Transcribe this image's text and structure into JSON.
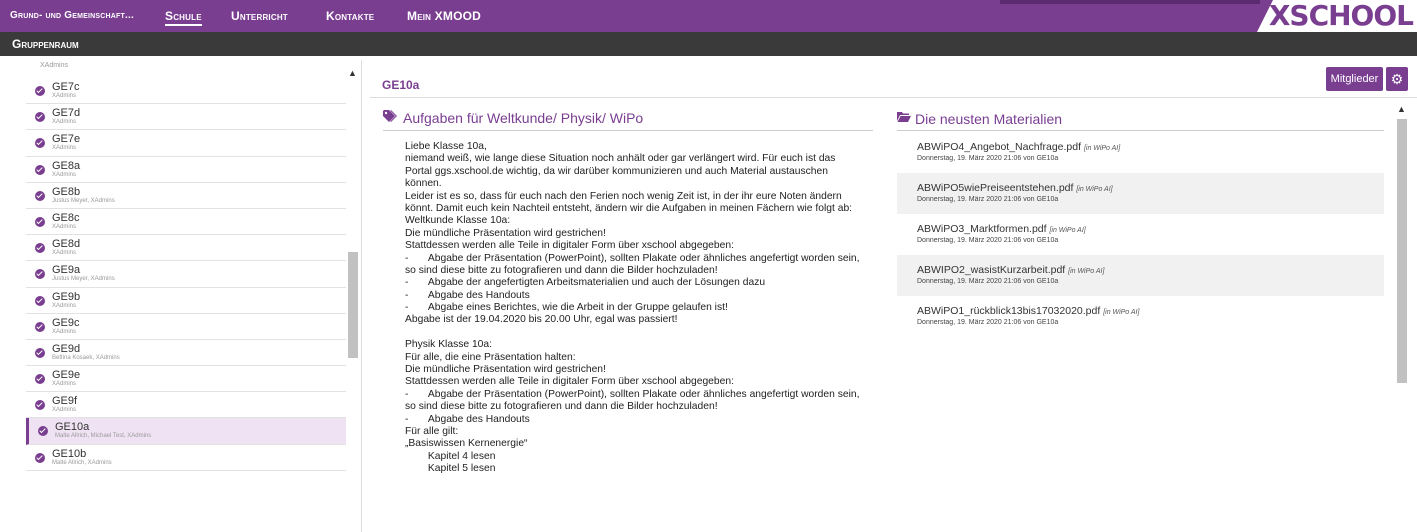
{
  "topnav": {
    "items": [
      {
        "label": "Grund- und Gemeinschaft...",
        "active": false
      },
      {
        "label": "Schule",
        "active": true
      },
      {
        "label": "Unterricht",
        "active": false
      },
      {
        "label": "Kontakte",
        "active": false
      },
      {
        "label": "Mein XMOOD",
        "active": false
      }
    ],
    "logo": "XSCHOOL"
  },
  "subbar": {
    "title": "Gruppenraum"
  },
  "sidebar": {
    "top_partial": "XAdmins",
    "items": [
      {
        "name": "GE7c",
        "sub": "XAdmins",
        "active": false
      },
      {
        "name": "GE7d",
        "sub": "XAdmins",
        "active": false
      },
      {
        "name": "GE7e",
        "sub": "XAdmins",
        "active": false
      },
      {
        "name": "GE8a",
        "sub": "XAdmins",
        "active": false
      },
      {
        "name": "GE8b",
        "sub": "Justus Meyer, XAdmins",
        "active": false
      },
      {
        "name": "GE8c",
        "sub": "XAdmins",
        "active": false
      },
      {
        "name": "GE8d",
        "sub": "XAdmins",
        "active": false
      },
      {
        "name": "GE9a",
        "sub": "Justus Meyer, XAdmins",
        "active": false
      },
      {
        "name": "GE9b",
        "sub": "XAdmins",
        "active": false
      },
      {
        "name": "GE9c",
        "sub": "XAdmins",
        "active": false
      },
      {
        "name": "GE9d",
        "sub": "Bettina Kosaek, XAdmins",
        "active": false
      },
      {
        "name": "GE9e",
        "sub": "XAdmins",
        "active": false
      },
      {
        "name": "GE9f",
        "sub": "XAdmins",
        "active": false
      },
      {
        "name": "GE10a",
        "sub": "Malte Allrich, Michael Test, XAdmins",
        "active": true
      },
      {
        "name": "GE10b",
        "sub": "Malte Allrich, XAdmins",
        "active": false
      }
    ]
  },
  "main": {
    "title": "GE10a",
    "members_label": "Mitglieder",
    "tasks": {
      "title": "Aufgaben für Weltkunde/ Physik/ WiPo",
      "lines": [
        "Liebe Klasse 10a,",
        "niemand weiß, wie lange diese Situation noch anhält oder gar verlängert wird. Für euch ist das",
        "Portal ggs.xschool.de wichtig, da wir darüber kommunizieren und auch Material austauschen",
        "können.",
        "Leider ist es so, dass für euch nach den Ferien noch wenig Zeit ist, in der ihr eure Noten ändern",
        "könnt. Damit euch kein Nachteil entsteht, ändern wir die Aufgaben in meinen Fächern wie folgt ab:",
        "Weltkunde Klasse 10a:",
        "Die mündliche Präsentation wird gestrichen!",
        "Stattdessen werden alle Teile in digitaler Form über xschool abgegeben:",
        "-       Abgabe der Präsentation (PowerPoint), sollten Plakate oder ähnliches angefertigt worden sein,",
        "so sind diese bitte zu fotografieren und dann die Bilder hochzuladen!",
        "-       Abgabe der angefertigten Arbeitsmaterialien und auch der Lösungen dazu",
        "-       Abgabe des Handouts",
        "-       Abgabe eines Berichtes, wie die Arbeit in der Gruppe gelaufen ist!",
        "Abgabe ist der 19.04.2020 bis 20.00 Uhr, egal was passiert!",
        "",
        "Physik Klasse 10a:",
        "Für alle, die eine Präsentation halten:",
        "Die mündliche Präsentation wird gestrichen!",
        "Stattdessen werden alle Teile in digitaler Form über xschool abgegeben:",
        "-       Abgabe der Präsentation (PowerPoint), sollten Plakate oder ähnliches angefertigt worden sein,",
        "so sind diese bitte zu fotografieren und dann die Bilder hochzuladen!",
        "-       Abgabe des Handouts",
        "Für alle gilt:",
        "„Basiswissen Kernenergie“",
        "        Kapitel 4 lesen",
        "        Kapitel 5 lesen"
      ]
    },
    "materials": {
      "title": "Die neusten Materialien",
      "items": [
        {
          "file": "ABWiPO4_Angebot_Nachfrage.pdf",
          "tag": "[in WiPo AI]",
          "meta": "Donnerstag, 19. März 2020 21:06 von GE10a"
        },
        {
          "file": "ABWiPO5wiePreiseentstehen.pdf",
          "tag": "[in WiPo AI]",
          "meta": "Donnerstag, 19. März 2020 21:06 von GE10a"
        },
        {
          "file": "ABWiPO3_Marktformen.pdf",
          "tag": "[in WiPo AI]",
          "meta": "Donnerstag, 19. März 2020 21:06 von GE10a"
        },
        {
          "file": "ABWIPO2_wasistKurzarbeit.pdf",
          "tag": "[in WiPo AI]",
          "meta": "Donnerstag, 19. März 2020 21:06 von GE10a"
        },
        {
          "file": "ABWiPO1_rückblick13bis17032020.pdf",
          "tag": "[in WiPo AI]",
          "meta": "Donnerstag, 19. März 2020 21:06 von GE10a"
        }
      ]
    }
  },
  "colors": {
    "brand": "#7a3e91",
    "subbar": "#3a3a3a",
    "active_row": "#efe3f3"
  }
}
